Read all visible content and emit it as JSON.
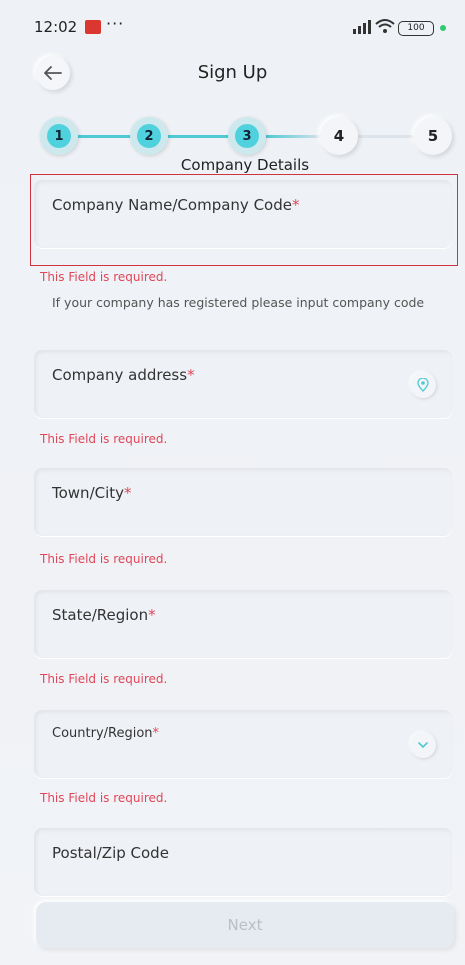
{
  "status_bar": {
    "time": "12:02",
    "dots": "···",
    "battery": "100"
  },
  "header": {
    "title": "Sign Up"
  },
  "stepper": {
    "steps": [
      "1",
      "2",
      "3",
      "4",
      "5"
    ],
    "current_step_caption": "Company Details"
  },
  "form": {
    "company_name": {
      "label": "Company Name/Company Code",
      "required_mark": "*",
      "error": "This Field is required.",
      "hint": "If your company has registered please input company code"
    },
    "company_address": {
      "label": "Company address",
      "required_mark": "*",
      "error": "This Field is required."
    },
    "town_city": {
      "label": "Town/City",
      "required_mark": "*",
      "error": "This Field is required."
    },
    "state_region": {
      "label": "State/Region",
      "required_mark": "*",
      "error": "This Field is required."
    },
    "country_region": {
      "label": "Country/Region",
      "required_mark": "*",
      "error": "This Field is required."
    },
    "postal_code": {
      "label": "Postal/Zip Code"
    }
  },
  "actions": {
    "next_label": "Next"
  },
  "colors": {
    "accent": "#4fd2dd",
    "error": "#e0475a",
    "highlight_border": "#d0353f"
  }
}
